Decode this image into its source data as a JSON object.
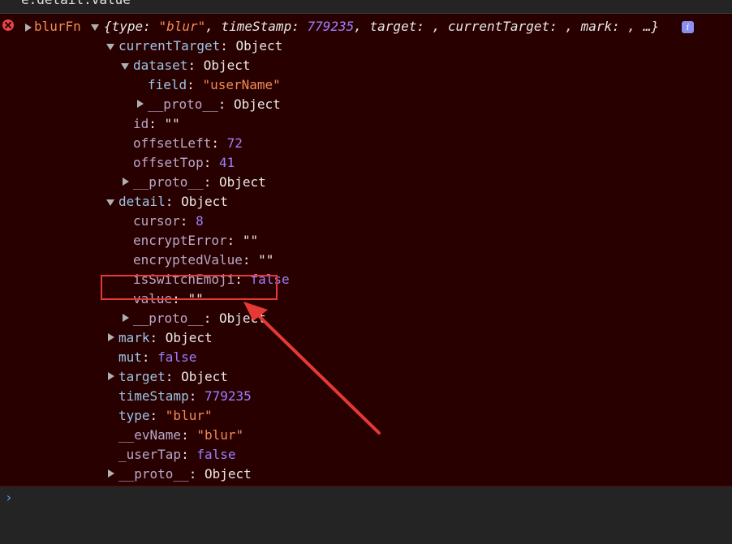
{
  "prev_command": "e.detail.value",
  "log": {
    "fn_name": "blurFn",
    "summary": {
      "open": "{",
      "type_key": "type",
      "type_val": "\"blur\"",
      "ts_key": "timeStamp",
      "ts_val": "779235",
      "target_key": "target",
      "ct_key": "currentTarget",
      "mark_key": "mark",
      "close": "…}"
    },
    "info_badge": "i"
  },
  "tree": {
    "currentTarget": "currentTarget",
    "object": "Object",
    "dataset": "dataset",
    "field_key": "field",
    "field_val": "\"userName\"",
    "proto": "__proto__",
    "id_key": "id",
    "id_val": "\"\"",
    "offsetLeft_key": "offsetLeft",
    "offsetLeft_val": "72",
    "offsetTop_key": "offsetTop",
    "offsetTop_val": "41",
    "detail": "detail",
    "cursor_key": "cursor",
    "cursor_val": "8",
    "encryptError_key": "encryptError",
    "encryptError_val": "\"\"",
    "encryptedValue_key": "encryptedValue",
    "encryptedValue_val": "\"\"",
    "isSwitchEmoji_key": "isSwitchEmoji",
    "isSwitchEmoji_val": "false",
    "value_key": "value",
    "value_val": "\"\"",
    "mark": "mark",
    "mut_key": "mut",
    "mut_val": "false",
    "target": "target",
    "timeStamp_key": "timeStamp",
    "timeStamp_val": "779235",
    "type_key": "type",
    "type_val": "\"blur\"",
    "evName_key": "__evName",
    "evName_val": "\"blur\"",
    "userTap_key": "_userTap",
    "userTap_val": "false"
  },
  "prompt_symbol": "›",
  "annotation": {
    "color": "#e53935"
  }
}
